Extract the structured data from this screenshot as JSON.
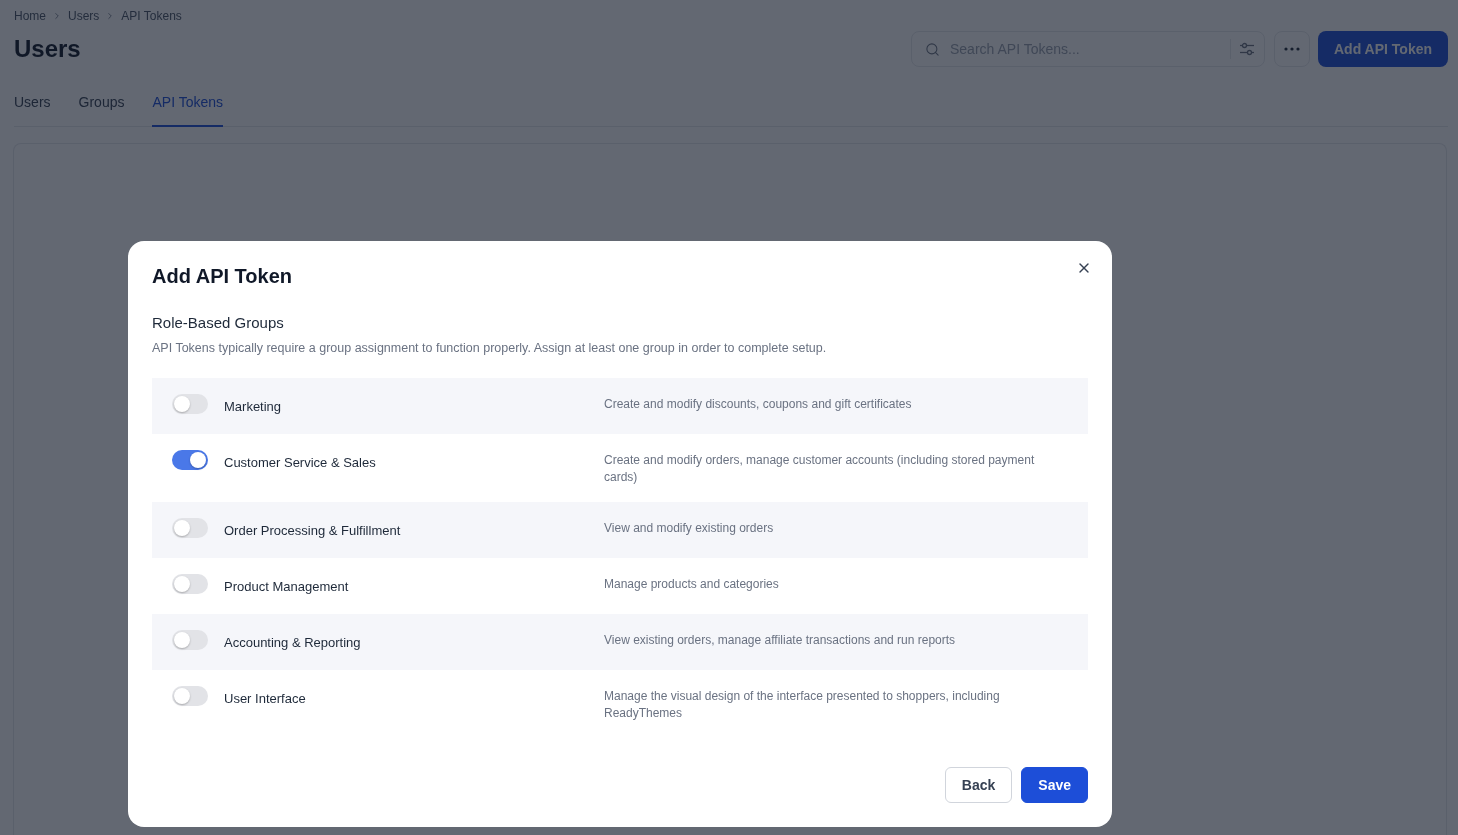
{
  "breadcrumb": [
    {
      "label": "Home"
    },
    {
      "label": "Users"
    },
    {
      "label": "API Tokens"
    }
  ],
  "page": {
    "title": "Users"
  },
  "search": {
    "placeholder": "Search API Tokens..."
  },
  "header_button": {
    "label": "Add API Token"
  },
  "tabs": [
    {
      "label": "Users",
      "selected": false
    },
    {
      "label": "Groups",
      "selected": false
    },
    {
      "label": "API Tokens",
      "selected": true
    }
  ],
  "dialog": {
    "title": "Add API Token",
    "section_title": "Role-Based Groups",
    "description": "API Tokens typically require a group assignment to function properly. Assign at least one group in order to complete setup.",
    "groups": [
      {
        "name": "Marketing",
        "description": "Create and modify discounts, coupons and gift certificates",
        "on": false
      },
      {
        "name": "Customer Service & Sales",
        "description": "Create and modify orders, manage customer accounts (including stored payment cards)",
        "on": true
      },
      {
        "name": "Order Processing & Fulfillment",
        "description": "View and modify existing orders",
        "on": false
      },
      {
        "name": "Product Management",
        "description": "Manage products and categories",
        "on": false
      },
      {
        "name": "Accounting & Reporting",
        "description": "View existing orders, manage affiliate transactions and run reports",
        "on": false
      },
      {
        "name": "User Interface",
        "description": "Manage the visual design of the interface presented to shoppers, including ReadyThemes",
        "on": false
      }
    ],
    "buttons": [
      {
        "label": "Back",
        "kind": "secondary"
      },
      {
        "label": "Save",
        "kind": "primary"
      }
    ]
  }
}
